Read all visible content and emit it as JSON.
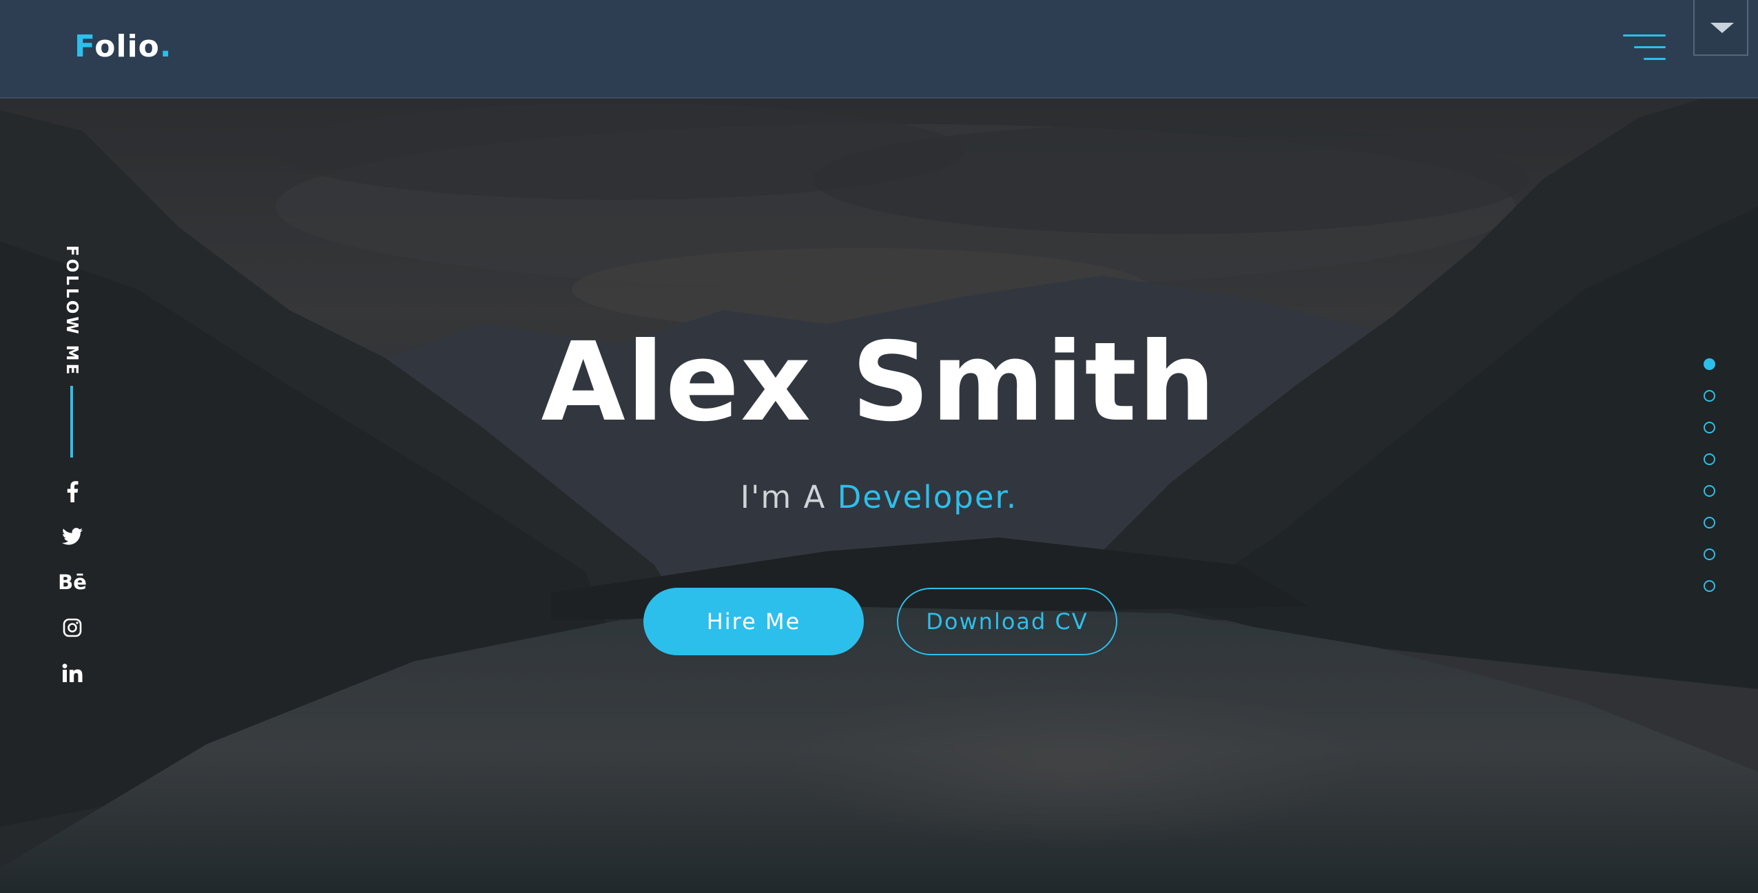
{
  "header": {
    "logo_first": "F",
    "logo_rest": "olio",
    "logo_dot": ".",
    "menu_icon": "hamburger-menu-icon",
    "dropdown_icon": "caret-down-icon"
  },
  "follow": {
    "label": "FOLLOW ME",
    "socials": [
      {
        "icon": "facebook-icon"
      },
      {
        "icon": "twitter-icon"
      },
      {
        "icon": "behance-icon",
        "text": "Bē"
      },
      {
        "icon": "instagram-icon"
      },
      {
        "icon": "linkedin-icon",
        "text": "in"
      }
    ]
  },
  "hero": {
    "name": "Alex Smith",
    "intro": "I'm A ",
    "role": "Developer.",
    "primary_button": "Hire Me",
    "secondary_button": "Download CV"
  },
  "nav_dots": {
    "count": 8,
    "active_index": 0
  },
  "colors": {
    "accent": "#2dbfeb",
    "header_bg": "#2d3e52",
    "text": "#ffffff"
  }
}
